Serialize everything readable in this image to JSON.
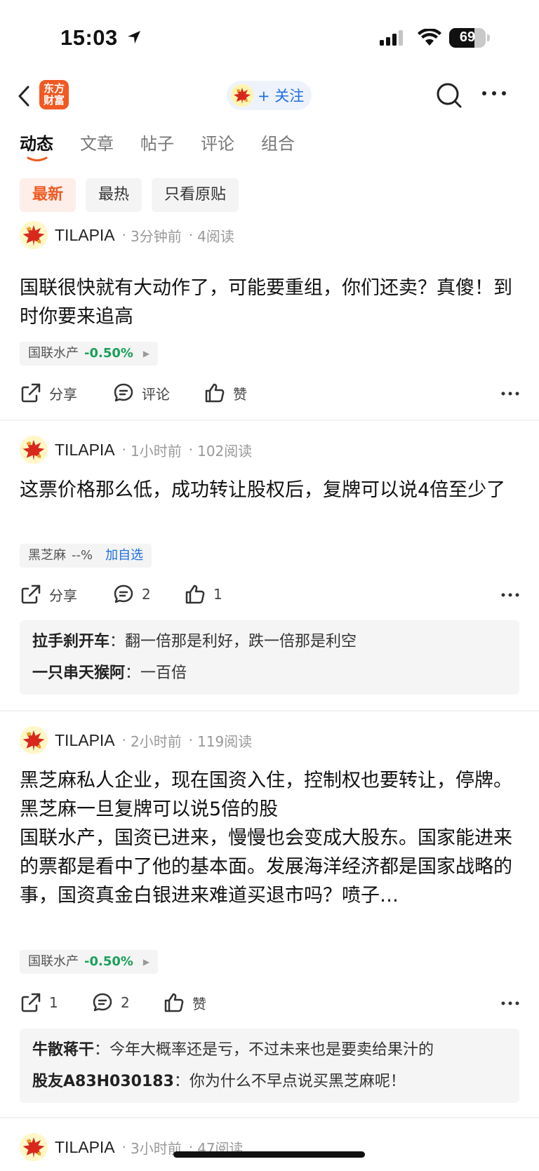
{
  "status_bar": {
    "time": "15:03",
    "battery": "69",
    "battery_level": 0.69
  },
  "nav": {
    "logo_line1": "东方",
    "logo_line2": "财富",
    "follow_label": "+ 关注"
  },
  "tabs": [
    "动态",
    "文章",
    "帖子",
    "评论",
    "组合"
  ],
  "filters": [
    "最新",
    "最热",
    "只看原贴"
  ],
  "colors": {
    "accent": "#f05a22",
    "link": "#1e6fe0",
    "down": "#1aa05b"
  },
  "posts": [
    {
      "user": "TILAPIA",
      "time": "3分钟前",
      "reads": "4阅读",
      "text": "国联很快就有大动作了，可能要重组，你们还卖？真傻！到时你要来追高",
      "stock": {
        "name": "国联水产",
        "change": "-0.50%",
        "add": ""
      },
      "share": "分享",
      "comment": "评论",
      "like": "赞",
      "replies": []
    },
    {
      "user": "TILAPIA",
      "time": "1小时前",
      "reads": "102阅读",
      "text": "这票价格那么低，成功转让股权后，复牌可以说4倍至少了",
      "stock": {
        "name": "黑芝麻",
        "change": "--%",
        "add": "加自选"
      },
      "share": "分享",
      "comment": "2",
      "like": "1",
      "replies": [
        {
          "author": "拉手刹开车",
          "text": "翻一倍那是利好，跌一倍那是利空"
        },
        {
          "author": "一只串天猴阿",
          "text": "一百倍"
        }
      ]
    },
    {
      "user": "TILAPIA",
      "time": "2小时前",
      "reads": "119阅读",
      "text": "黑芝麻私人企业，现在国资入住，控制权也要转让，停牌。\n黑芝麻一旦复牌可以说5倍的股\n国联水产，国资已进来，慢慢也会变成大股东。国家能进来的票都是看中了他的基本面。发展海洋经济都是国家战略的事，国资真金白银进来难道买退市吗？喷子…",
      "stock": {
        "name": "国联水产",
        "change": "-0.50%",
        "add": ""
      },
      "share": "1",
      "comment": "2",
      "like": "赞",
      "replies": [
        {
          "author": "牛散蒋干",
          "text": "今年大概率还是亏，不过未来也是要卖给果汁的"
        },
        {
          "author": "股友A83H030183",
          "text": "你为什么不早点说买黑芝麻呢！"
        }
      ]
    },
    {
      "user": "TILAPIA",
      "time": "3小时前",
      "reads": "47阅读"
    }
  ]
}
